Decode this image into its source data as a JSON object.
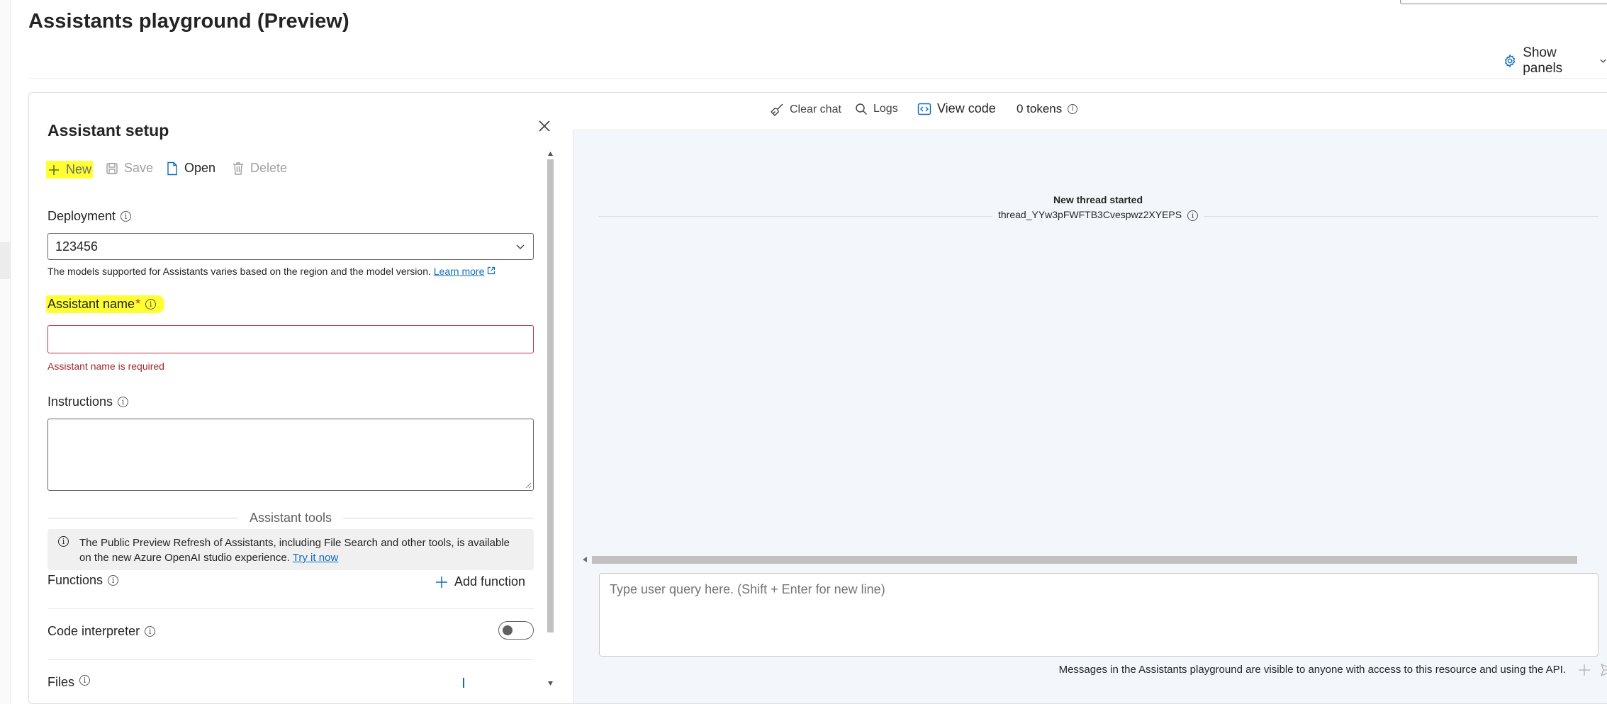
{
  "page": {
    "title": "Assistants playground (Preview)",
    "show_panels_label": "Show panels"
  },
  "setup": {
    "title": "Assistant setup",
    "toolbar": {
      "new_label": "New",
      "save_label": "Save",
      "open_label": "Open",
      "delete_label": "Delete"
    },
    "deployment": {
      "label": "Deployment",
      "value": "123456",
      "hint": "The models supported for Assistants varies based on the region and the model version.",
      "learn_more": "Learn more"
    },
    "assistant_name": {
      "label": "Assistant name",
      "required_mark": "*",
      "value": "",
      "error": "Assistant name is required"
    },
    "instructions": {
      "label": "Instructions",
      "value": ""
    },
    "tools": {
      "heading": "Assistant tools",
      "notice_text": "The Public Preview Refresh of Assistants, including File Search and other tools, is available on the new Azure OpenAI studio experience.",
      "notice_link": "Try it now",
      "functions_label": "Functions",
      "add_function_label": "Add function",
      "code_interpreter_label": "Code interpreter",
      "code_interpreter_enabled": false,
      "files_label": "Files"
    },
    "highlight_color": "#ffff33"
  },
  "chat": {
    "toolbar": {
      "clear_chat": "Clear chat",
      "logs": "Logs",
      "view_code": "View code",
      "tokens": "0 tokens"
    },
    "thread": {
      "status": "New thread started",
      "id": "thread_YYw3pFWFTB3Cvespwz2XYEPS"
    },
    "query_placeholder": "Type user query here. (Shift + Enter for new line)",
    "footer_notice": "Messages in the Assistants playground are visible to anyone with access to this resource and using the API.",
    "accent_color": "#0f6cbd"
  }
}
